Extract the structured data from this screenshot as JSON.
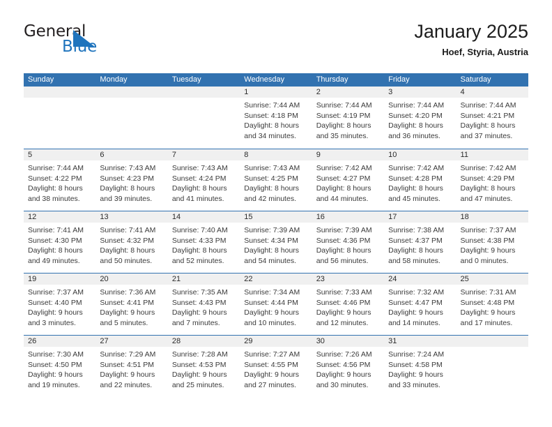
{
  "logo": {
    "word1": "General",
    "word2": "Blue",
    "triangle_color": "#1f74bd",
    "text_color": "#231f20"
  },
  "header": {
    "title": "January 2025",
    "subtitle": "Hoef, Styria, Austria"
  },
  "theme": {
    "header_blue": "#3272b0",
    "daynum_band": "#f0f0f0",
    "body_text": "#3a3a3a"
  },
  "weekdays": [
    "Sunday",
    "Monday",
    "Tuesday",
    "Wednesday",
    "Thursday",
    "Friday",
    "Saturday"
  ],
  "weeks": [
    [
      {
        "day": "",
        "empty": true
      },
      {
        "day": "",
        "empty": true
      },
      {
        "day": "",
        "empty": true
      },
      {
        "day": "1",
        "sunrise": "Sunrise: 7:44 AM",
        "sunset": "Sunset: 4:18 PM",
        "daylight1": "Daylight: 8 hours",
        "daylight2": "and 34 minutes."
      },
      {
        "day": "2",
        "sunrise": "Sunrise: 7:44 AM",
        "sunset": "Sunset: 4:19 PM",
        "daylight1": "Daylight: 8 hours",
        "daylight2": "and 35 minutes."
      },
      {
        "day": "3",
        "sunrise": "Sunrise: 7:44 AM",
        "sunset": "Sunset: 4:20 PM",
        "daylight1": "Daylight: 8 hours",
        "daylight2": "and 36 minutes."
      },
      {
        "day": "4",
        "sunrise": "Sunrise: 7:44 AM",
        "sunset": "Sunset: 4:21 PM",
        "daylight1": "Daylight: 8 hours",
        "daylight2": "and 37 minutes."
      }
    ],
    [
      {
        "day": "5",
        "sunrise": "Sunrise: 7:44 AM",
        "sunset": "Sunset: 4:22 PM",
        "daylight1": "Daylight: 8 hours",
        "daylight2": "and 38 minutes."
      },
      {
        "day": "6",
        "sunrise": "Sunrise: 7:43 AM",
        "sunset": "Sunset: 4:23 PM",
        "daylight1": "Daylight: 8 hours",
        "daylight2": "and 39 minutes."
      },
      {
        "day": "7",
        "sunrise": "Sunrise: 7:43 AM",
        "sunset": "Sunset: 4:24 PM",
        "daylight1": "Daylight: 8 hours",
        "daylight2": "and 41 minutes."
      },
      {
        "day": "8",
        "sunrise": "Sunrise: 7:43 AM",
        "sunset": "Sunset: 4:25 PM",
        "daylight1": "Daylight: 8 hours",
        "daylight2": "and 42 minutes."
      },
      {
        "day": "9",
        "sunrise": "Sunrise: 7:42 AM",
        "sunset": "Sunset: 4:27 PM",
        "daylight1": "Daylight: 8 hours",
        "daylight2": "and 44 minutes."
      },
      {
        "day": "10",
        "sunrise": "Sunrise: 7:42 AM",
        "sunset": "Sunset: 4:28 PM",
        "daylight1": "Daylight: 8 hours",
        "daylight2": "and 45 minutes."
      },
      {
        "day": "11",
        "sunrise": "Sunrise: 7:42 AM",
        "sunset": "Sunset: 4:29 PM",
        "daylight1": "Daylight: 8 hours",
        "daylight2": "and 47 minutes."
      }
    ],
    [
      {
        "day": "12",
        "sunrise": "Sunrise: 7:41 AM",
        "sunset": "Sunset: 4:30 PM",
        "daylight1": "Daylight: 8 hours",
        "daylight2": "and 49 minutes."
      },
      {
        "day": "13",
        "sunrise": "Sunrise: 7:41 AM",
        "sunset": "Sunset: 4:32 PM",
        "daylight1": "Daylight: 8 hours",
        "daylight2": "and 50 minutes."
      },
      {
        "day": "14",
        "sunrise": "Sunrise: 7:40 AM",
        "sunset": "Sunset: 4:33 PM",
        "daylight1": "Daylight: 8 hours",
        "daylight2": "and 52 minutes."
      },
      {
        "day": "15",
        "sunrise": "Sunrise: 7:39 AM",
        "sunset": "Sunset: 4:34 PM",
        "daylight1": "Daylight: 8 hours",
        "daylight2": "and 54 minutes."
      },
      {
        "day": "16",
        "sunrise": "Sunrise: 7:39 AM",
        "sunset": "Sunset: 4:36 PM",
        "daylight1": "Daylight: 8 hours",
        "daylight2": "and 56 minutes."
      },
      {
        "day": "17",
        "sunrise": "Sunrise: 7:38 AM",
        "sunset": "Sunset: 4:37 PM",
        "daylight1": "Daylight: 8 hours",
        "daylight2": "and 58 minutes."
      },
      {
        "day": "18",
        "sunrise": "Sunrise: 7:37 AM",
        "sunset": "Sunset: 4:38 PM",
        "daylight1": "Daylight: 9 hours",
        "daylight2": "and 0 minutes."
      }
    ],
    [
      {
        "day": "19",
        "sunrise": "Sunrise: 7:37 AM",
        "sunset": "Sunset: 4:40 PM",
        "daylight1": "Daylight: 9 hours",
        "daylight2": "and 3 minutes."
      },
      {
        "day": "20",
        "sunrise": "Sunrise: 7:36 AM",
        "sunset": "Sunset: 4:41 PM",
        "daylight1": "Daylight: 9 hours",
        "daylight2": "and 5 minutes."
      },
      {
        "day": "21",
        "sunrise": "Sunrise: 7:35 AM",
        "sunset": "Sunset: 4:43 PM",
        "daylight1": "Daylight: 9 hours",
        "daylight2": "and 7 minutes."
      },
      {
        "day": "22",
        "sunrise": "Sunrise: 7:34 AM",
        "sunset": "Sunset: 4:44 PM",
        "daylight1": "Daylight: 9 hours",
        "daylight2": "and 10 minutes."
      },
      {
        "day": "23",
        "sunrise": "Sunrise: 7:33 AM",
        "sunset": "Sunset: 4:46 PM",
        "daylight1": "Daylight: 9 hours",
        "daylight2": "and 12 minutes."
      },
      {
        "day": "24",
        "sunrise": "Sunrise: 7:32 AM",
        "sunset": "Sunset: 4:47 PM",
        "daylight1": "Daylight: 9 hours",
        "daylight2": "and 14 minutes."
      },
      {
        "day": "25",
        "sunrise": "Sunrise: 7:31 AM",
        "sunset": "Sunset: 4:48 PM",
        "daylight1": "Daylight: 9 hours",
        "daylight2": "and 17 minutes."
      }
    ],
    [
      {
        "day": "26",
        "sunrise": "Sunrise: 7:30 AM",
        "sunset": "Sunset: 4:50 PM",
        "daylight1": "Daylight: 9 hours",
        "daylight2": "and 19 minutes."
      },
      {
        "day": "27",
        "sunrise": "Sunrise: 7:29 AM",
        "sunset": "Sunset: 4:51 PM",
        "daylight1": "Daylight: 9 hours",
        "daylight2": "and 22 minutes."
      },
      {
        "day": "28",
        "sunrise": "Sunrise: 7:28 AM",
        "sunset": "Sunset: 4:53 PM",
        "daylight1": "Daylight: 9 hours",
        "daylight2": "and 25 minutes."
      },
      {
        "day": "29",
        "sunrise": "Sunrise: 7:27 AM",
        "sunset": "Sunset: 4:55 PM",
        "daylight1": "Daylight: 9 hours",
        "daylight2": "and 27 minutes."
      },
      {
        "day": "30",
        "sunrise": "Sunrise: 7:26 AM",
        "sunset": "Sunset: 4:56 PM",
        "daylight1": "Daylight: 9 hours",
        "daylight2": "and 30 minutes."
      },
      {
        "day": "31",
        "sunrise": "Sunrise: 7:24 AM",
        "sunset": "Sunset: 4:58 PM",
        "daylight1": "Daylight: 9 hours",
        "daylight2": "and 33 minutes."
      },
      {
        "day": "",
        "empty": true
      }
    ]
  ]
}
